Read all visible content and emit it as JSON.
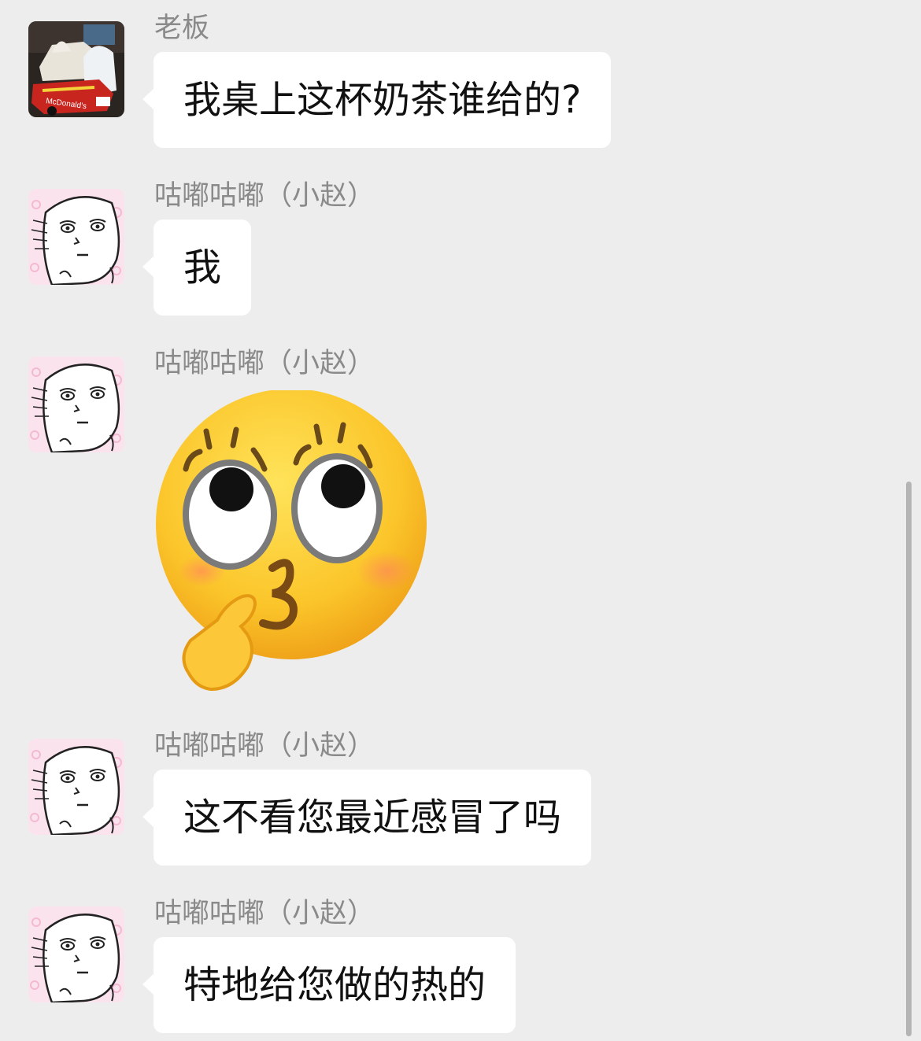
{
  "messages": [
    {
      "sender": "老板",
      "text": "我桌上这杯奶茶谁给的?",
      "avatar": "boss-avatar-icon"
    },
    {
      "sender": "咕嘟咕嘟（小赵）",
      "text": "我",
      "avatar": "sketch-face-avatar-icon"
    },
    {
      "sender": "咕嘟咕嘟（小赵）",
      "sticker": "kissing-emoji-sticker-icon",
      "avatar": "sketch-face-avatar-icon"
    },
    {
      "sender": "咕嘟咕嘟（小赵）",
      "text": "这不看您最近感冒了吗",
      "avatar": "sketch-face-avatar-icon"
    },
    {
      "sender": "咕嘟咕嘟（小赵）",
      "text": "特地给您做的热的",
      "avatar": "sketch-face-avatar-icon"
    }
  ],
  "colors": {
    "background": "#ededed",
    "bubble": "#ffffff",
    "sender_text": "#8a8a8a",
    "message_text": "#111111"
  }
}
